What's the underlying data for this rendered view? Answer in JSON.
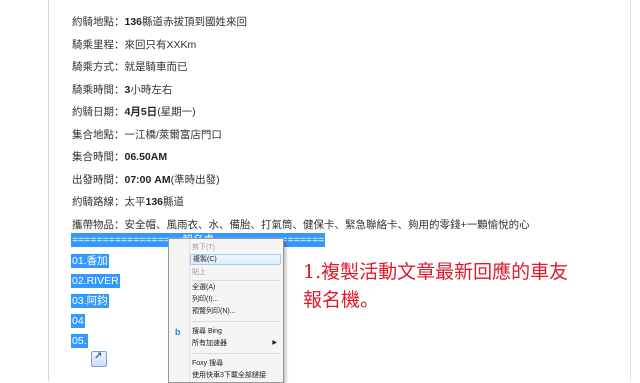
{
  "ride_info": [
    {
      "label": "約騎地點：",
      "value": "136縣道赤拔頂到國姓來回",
      "bold": "136"
    },
    {
      "label": "騎乘里程：",
      "value": "來回只有XXKm"
    },
    {
      "label": "騎乘方式：",
      "value": "就是騎車而已"
    },
    {
      "label": "騎乘時間：",
      "value": "3小時左右",
      "bold": "3"
    },
    {
      "label": "約騎日期：",
      "value": "4月5日(星期一)",
      "bold": "4月5日"
    },
    {
      "label": "集合地點：",
      "value": "一江橋/萊爾富店門口"
    },
    {
      "label": "集合時間：",
      "value": "06.50AM",
      "bold": "06.50AM"
    },
    {
      "label": "出發時間：",
      "value": "07:00 AM(準時出發)",
      "bold": "07:00 AM"
    },
    {
      "label": "約騎路線：",
      "value": "太平136縣道",
      "bold": "136"
    },
    {
      "label": "攜帶物品：",
      "value": "安全帽、風雨衣、水、備胎、打氣筒、健保卡、緊急聯絡卡、夠用的零錢+一顆愉悅的心"
    }
  ],
  "selection": {
    "divider": "==================報名處==================",
    "entries": [
      "01.香加",
      "02.RIVER",
      "03.阿鈞",
      "04",
      "05."
    ]
  },
  "context_menu": {
    "items": [
      {
        "label": "剪下(T)",
        "disabled": true
      },
      {
        "label": "複製(C)",
        "disabled": false,
        "hover": true
      },
      {
        "label": "貼上",
        "disabled": true
      },
      {
        "label": "全選(A)",
        "disabled": false
      },
      {
        "label": "列印(I)...",
        "disabled": false
      },
      {
        "label": "預覽列印(N)...",
        "disabled": false
      },
      {
        "label": "搜尋 Bing",
        "disabled": false,
        "icon": "bing-icon"
      },
      {
        "label": "所有加速器",
        "disabled": false,
        "submenu": true
      },
      {
        "label": "Foxy 搜尋",
        "disabled": false
      },
      {
        "label": "使用快車3下載全部鏈接",
        "disabled": false
      }
    ]
  },
  "annotation": {
    "line1": "1.複製活動文章最新回應的車友",
    "line2": "報名機。"
  },
  "colors": {
    "selection": "#3399ff",
    "annotation": "#e0192b"
  }
}
